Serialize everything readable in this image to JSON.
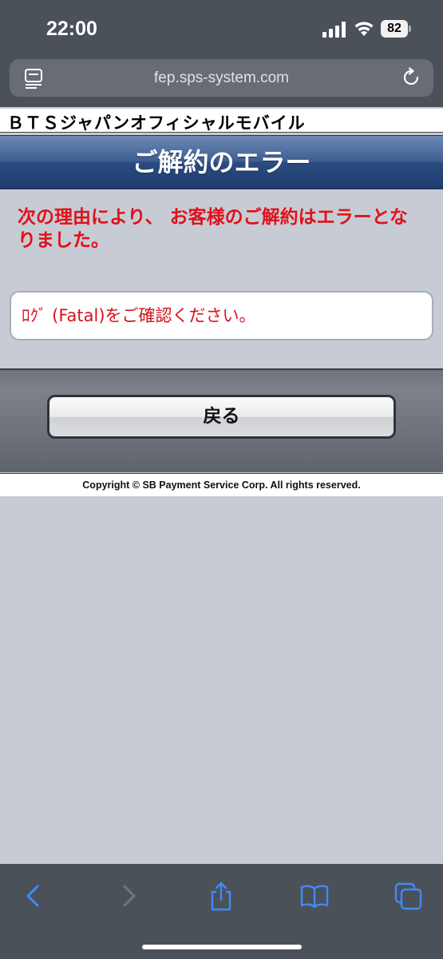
{
  "status_bar": {
    "time": "22:00",
    "battery_level": "82",
    "icons": [
      "signal-icon",
      "wifi-icon",
      "battery-icon"
    ]
  },
  "browser": {
    "url": "fep.sps-system.com",
    "icons": [
      "reader-icon",
      "reload-icon"
    ]
  },
  "page": {
    "site_title": "ＢＴＳジャパンオフィシャルモバイル",
    "heading": "ご解約のエラー",
    "error_message": "次の理由により、 お客様のご解約はエラーとなりました。",
    "log_message": "ﾛｸﾞ (Fatal)をご確認ください。",
    "back_button_label": "戻る",
    "copyright": "Copyright © SB Payment Service Corp. All rights reserved."
  },
  "toolbar": {
    "icons": [
      "back-icon",
      "forward-icon",
      "share-icon",
      "bookmarks-icon",
      "tabs-icon"
    ]
  },
  "colors": {
    "chrome": "#4b5158",
    "title_bar": "#2b4b80",
    "error_text": "#e1101a",
    "page_background": "#c7ccd4",
    "link_blue": "#3d8bff"
  }
}
